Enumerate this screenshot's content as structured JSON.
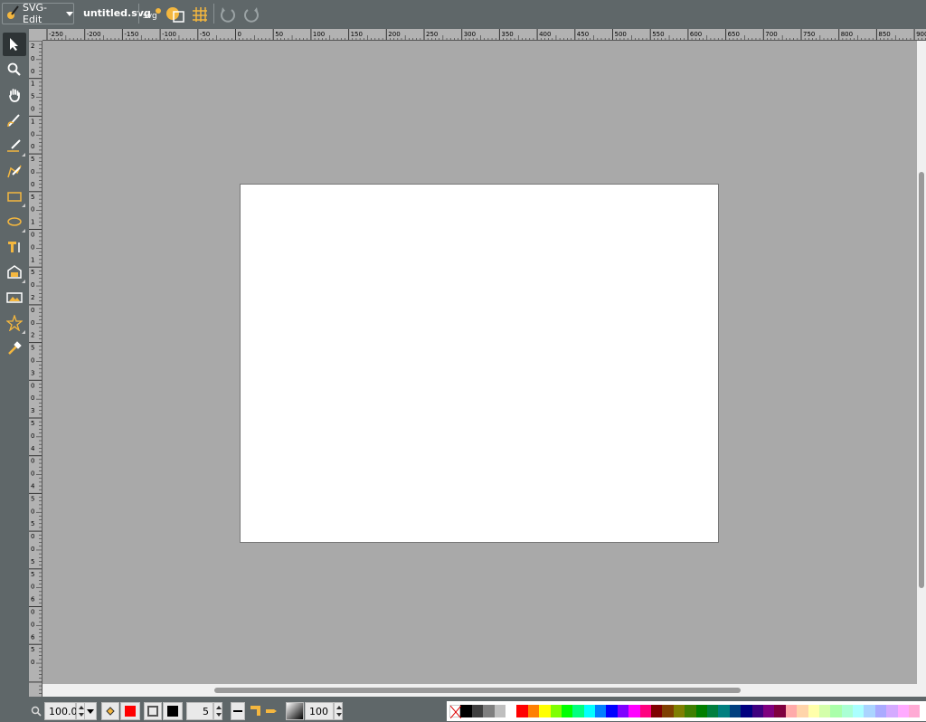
{
  "app_menu": {
    "label": "SVG-Edit"
  },
  "document": {
    "title": "untitled.svg"
  },
  "top_tools": [
    {
      "name": "svg-source-icon",
      "glyph": "svg"
    },
    {
      "name": "wireframe-icon"
    },
    {
      "name": "grid-icon"
    },
    {
      "name": "undo-icon"
    },
    {
      "name": "redo-icon"
    }
  ],
  "left_tools": [
    {
      "name": "select-tool",
      "icon": "cursor-icon",
      "active": true
    },
    {
      "name": "zoom-tool",
      "icon": "zoom-icon"
    },
    {
      "name": "pan-tool",
      "icon": "hand-icon"
    },
    {
      "name": "pencil-tool",
      "icon": "pencil-icon"
    },
    {
      "name": "line-tool",
      "icon": "pen-line-icon"
    },
    {
      "name": "path-tool",
      "icon": "path-icon"
    },
    {
      "name": "rect-tool",
      "icon": "rectangle-icon"
    },
    {
      "name": "ellipse-tool",
      "icon": "ellipse-icon"
    },
    {
      "name": "text-tool",
      "icon": "text-icon"
    },
    {
      "name": "image-tool",
      "icon": "image-icon"
    },
    {
      "name": "library-tool",
      "icon": "library-image-icon"
    },
    {
      "name": "star-tool",
      "icon": "star-icon"
    },
    {
      "name": "eyedropper-tool",
      "icon": "eyedropper-icon"
    }
  ],
  "ruler_top": [
    "-250",
    "-200",
    "-150",
    "-100",
    "-50",
    "0",
    "50",
    "100",
    "150",
    "200",
    "250",
    "300",
    "350",
    "400",
    "450",
    "500",
    "550",
    "600",
    "650",
    "700",
    "750",
    "800",
    "850",
    "900"
  ],
  "ruler_left": [
    "2",
    "0",
    "0",
    "1",
    "5",
    "0",
    "1",
    "0",
    "0",
    "5",
    "0",
    "0",
    "5",
    "0",
    "1",
    "0",
    "0",
    "1",
    "5",
    "0",
    "2",
    "0",
    "0",
    "2",
    "5",
    "0",
    "3",
    "0",
    "0",
    "3",
    "5",
    "0",
    "4",
    "0",
    "0",
    "4",
    "5",
    "0",
    "5",
    "0",
    "0",
    "5",
    "5",
    "0",
    "6",
    "0",
    "0",
    "6",
    "5",
    "0"
  ],
  "bottom": {
    "zoom_value": "100.0",
    "fill_color": "#ff0000",
    "stroke_color": "#000000",
    "stroke_width": "5",
    "opacity": "100"
  },
  "palette": [
    "#000000",
    "#3f3f3f",
    "#7f7f7f",
    "#bfbfbf",
    "#ffffff",
    "#ff0000",
    "#ff7f00",
    "#ffff00",
    "#7fff00",
    "#00ff00",
    "#00ff7f",
    "#00ffff",
    "#007fff",
    "#0000ff",
    "#7f00ff",
    "#ff00ff",
    "#ff007f",
    "#7f0000",
    "#7f3f00",
    "#7f7f00",
    "#3f7f00",
    "#007f00",
    "#007f3f",
    "#007f7f",
    "#003f7f",
    "#00007f",
    "#3f007f",
    "#7f007f",
    "#7f003f",
    "#ffaaaa",
    "#ffd4aa",
    "#ffffaa",
    "#d4ffaa",
    "#aaffaa",
    "#aaffd4",
    "#aaffff",
    "#aad4ff",
    "#aaaaff",
    "#d4aaff",
    "#ffaaff",
    "#ffaad4"
  ]
}
